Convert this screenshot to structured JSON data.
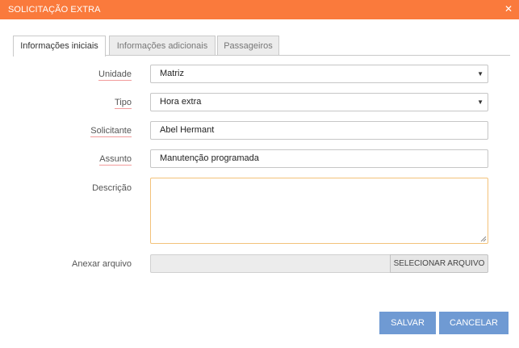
{
  "window": {
    "title": "SOLICITAÇÃO EXTRA",
    "close_icon": "close-icon",
    "accent": "#fa7a3c"
  },
  "tabs": [
    {
      "label": "Informações iniciais",
      "active": true
    },
    {
      "label": "Informações adicionais",
      "active": false
    },
    {
      "label": "Passageiros",
      "active": false
    }
  ],
  "form": {
    "unidade": {
      "label": "Unidade",
      "value": "Matriz"
    },
    "tipo": {
      "label": "Tipo",
      "value": "Hora extra"
    },
    "solicitante": {
      "label": "Solicitante",
      "value": "Abel Hermant"
    },
    "assunto": {
      "label": "Assunto",
      "value": "Manutenção programada"
    },
    "descricao": {
      "label": "Descrição",
      "value": ""
    },
    "anexo": {
      "label": "Anexar arquivo",
      "button": "SELECIONAR ARQUIVO"
    }
  },
  "actions": {
    "save": "SALVAR",
    "cancel": "CANCELAR",
    "button_color": "#6f9ad3"
  }
}
